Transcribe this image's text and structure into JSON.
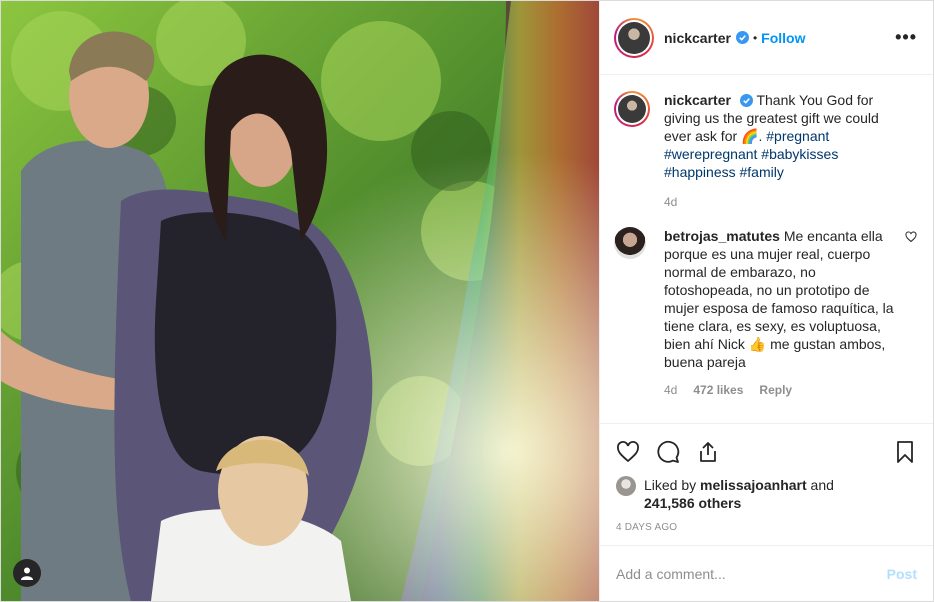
{
  "header": {
    "username": "nickcarter",
    "dot": "•",
    "follow_label": "Follow",
    "more_label": "•••"
  },
  "caption": {
    "username": "nickcarter",
    "text": "Thank You God for giving us the greatest gift we could ever ask for 🌈.",
    "hashtags": "#pregnant #werepregnant #babykisses #happiness #family",
    "age": "4d"
  },
  "comment": {
    "username": "betrojas_matutes",
    "text": "Me encanta ella porque es una mujer real, cuerpo normal de embarazo, no fotoshopeada, no un prototipo de mujer esposa de famoso raquítica, la tiene clara, es sexy, es voluptuosa, bien ahí Nick 👍 me gustan ambos, buena pareja",
    "age": "4d",
    "likes": "472 likes",
    "reply_label": "Reply"
  },
  "likes": {
    "prefix": "Liked by",
    "user": "melissajoanhart",
    "and": "and",
    "others": "241,586 others"
  },
  "timestamp": "4 DAYS AGO",
  "add_comment": {
    "placeholder": "Add a comment...",
    "post_label": "Post"
  },
  "icons": {
    "like": "heart-icon",
    "comment": "comment-icon",
    "share": "share-icon",
    "save": "bookmark-icon",
    "tag": "user-tag-icon",
    "verified": "verified-badge-icon"
  },
  "colors": {
    "link": "#0095f6",
    "hashtag": "#00376b",
    "muted": "#8e8e8e",
    "post_disabled": "#b2dffc"
  }
}
